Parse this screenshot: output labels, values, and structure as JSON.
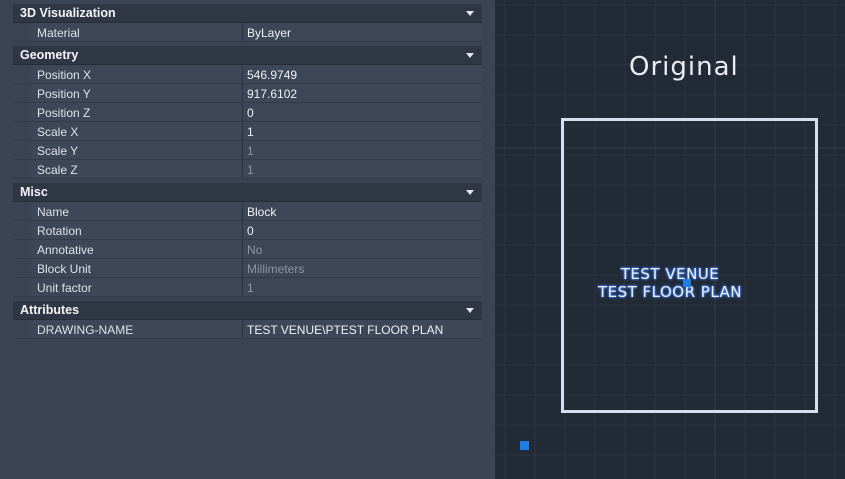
{
  "sections": [
    {
      "title": "3D Visualization",
      "rows": [
        {
          "name": "Material",
          "value": "ByLayer",
          "muted": false
        }
      ]
    },
    {
      "title": "Geometry",
      "rows": [
        {
          "name": "Position X",
          "value": "546.9749",
          "muted": false
        },
        {
          "name": "Position Y",
          "value": "917.6102",
          "muted": false
        },
        {
          "name": "Position Z",
          "value": "0",
          "muted": false
        },
        {
          "name": "Scale X",
          "value": "1",
          "muted": false
        },
        {
          "name": "Scale Y",
          "value": "1",
          "muted": true
        },
        {
          "name": "Scale Z",
          "value": "1",
          "muted": true
        }
      ]
    },
    {
      "title": "Misc",
      "rows": [
        {
          "name": "Name",
          "value": "Block",
          "muted": false
        },
        {
          "name": "Rotation",
          "value": "0",
          "muted": false
        },
        {
          "name": "Annotative",
          "value": "No",
          "muted": true
        },
        {
          "name": "Block Unit",
          "value": "Millimeters",
          "muted": true
        },
        {
          "name": "Unit factor",
          "value": "1",
          "muted": true
        }
      ]
    },
    {
      "title": "Attributes",
      "rows": [
        {
          "name": "DRAWING-NAME",
          "value": "TEST VENUE\\PTEST FLOOR PLAN",
          "muted": false
        }
      ]
    }
  ],
  "viewport": {
    "title": "Original",
    "block_text_line1": "TEST VENUE",
    "block_text_line2": "TEST FLOOR PLAN"
  },
  "colors": {
    "panel_bg": "#3b4453",
    "header_bg": "#2f3745",
    "viewport_bg": "#222a35",
    "grid_line": "#2b3441",
    "grip": "#1e7ee8",
    "text_glow": "#3f7fff"
  },
  "icons": {
    "section_toggle": "chevron-down-icon",
    "selection_grip": "grip-square-icon"
  }
}
